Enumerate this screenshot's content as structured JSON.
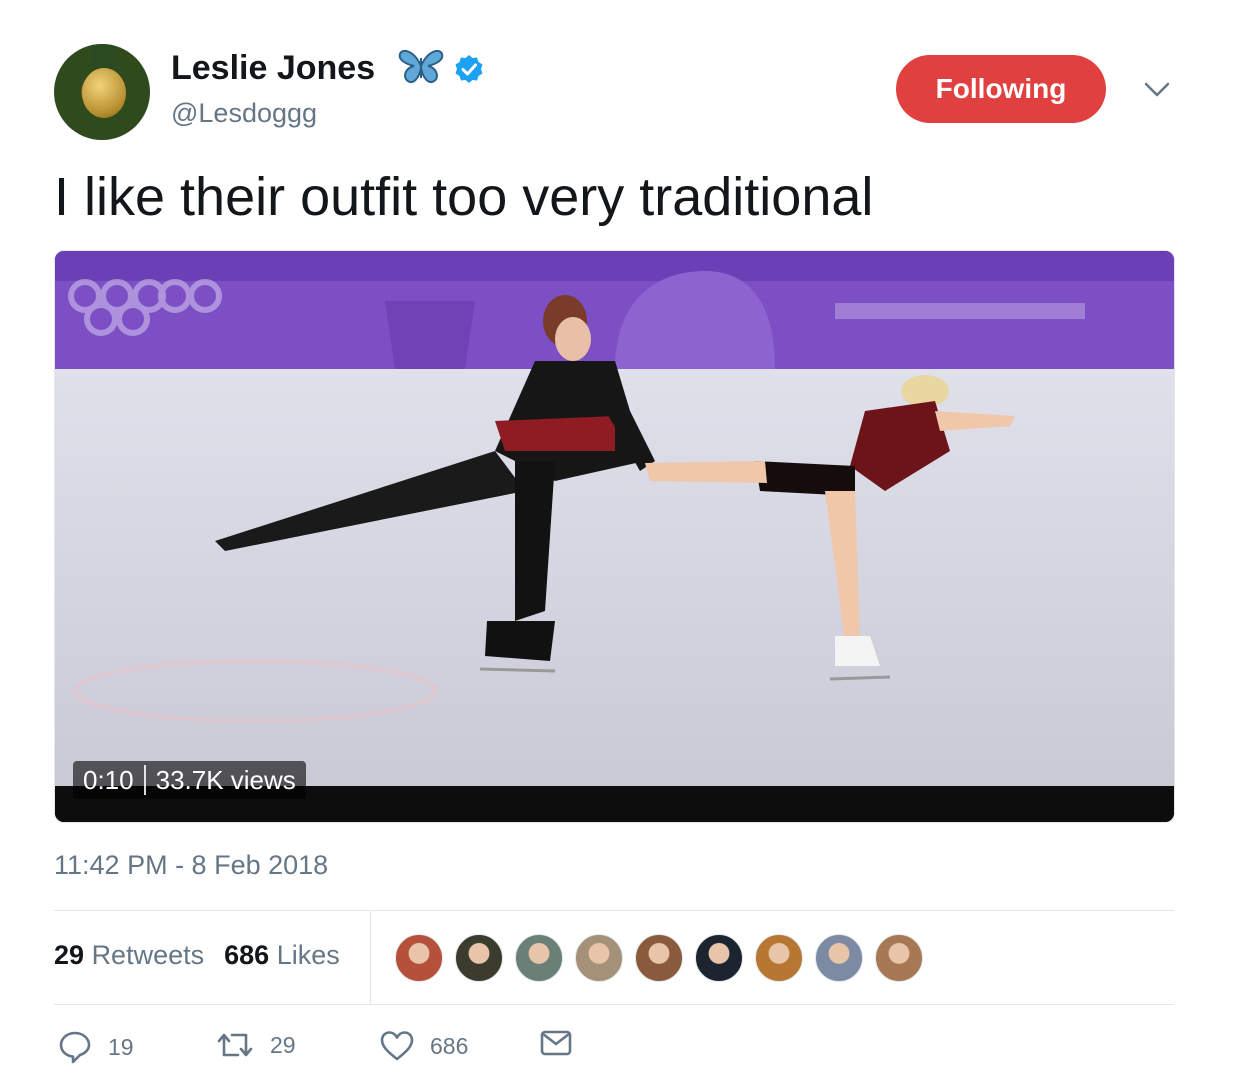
{
  "author": {
    "name": "Leslie Jones",
    "handle": "@Lesdoggg",
    "name_emoji_icon": "butterfly-icon",
    "verified_icon": "verified-badge-icon"
  },
  "follow_button": {
    "label": "Following",
    "color": "#e0403f"
  },
  "menu": {
    "icon": "chevron-down-icon"
  },
  "tweet": {
    "text": "I like their outfit too very traditional"
  },
  "video": {
    "duration": "0:10",
    "views": "33.7K views"
  },
  "timestamp": "11:42 PM - 8 Feb 2018",
  "stats": {
    "retweets_count": "29",
    "retweets_label": "Retweets",
    "likes_count": "686",
    "likes_label": "Likes"
  },
  "liker_avatars": [
    "#b5513a",
    "#3b3b2e",
    "#6a7f76",
    "#a59178",
    "#8a5a3c",
    "#1c2430",
    "#b77732",
    "#7c8aa3",
    "#a67954"
  ],
  "actions": {
    "reply_count": "19",
    "retweet_count": "29",
    "like_count": "686",
    "reply_icon": "reply-icon",
    "retweet_icon": "retweet-icon",
    "like_icon": "heart-icon",
    "dm_icon": "envelope-icon"
  },
  "colors": {
    "text": "#14171a",
    "secondary": "#657786",
    "verified": "#1da1f2"
  }
}
